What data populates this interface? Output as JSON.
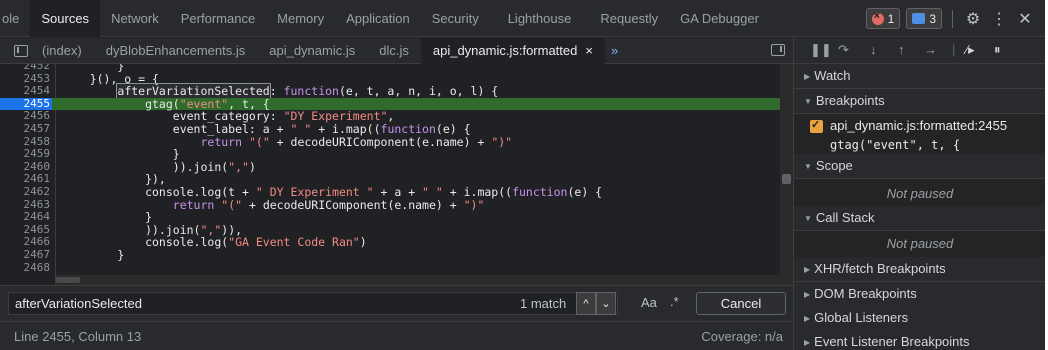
{
  "top_tabs": [
    "ole",
    "Sources",
    "Network",
    "Performance",
    "Memory",
    "Application",
    "Security",
    "Lighthouse",
    "Requestly",
    "GA Debugger"
  ],
  "top_tabs_active": "Sources",
  "errors_count": "1",
  "messages_count": "3",
  "icons": {
    "settings": "gear-icon",
    "more": "kebab-icon",
    "close": "close-icon"
  },
  "file_tabs": [
    "(index)",
    "dyBlobEnhancements.js",
    "api_dynamic.js",
    "dlc.js",
    "api_dynamic.js:formatted"
  ],
  "file_tabs_active": "api_dynamic.js:formatted",
  "file_tab_close": "×",
  "file_tabs_more": "»",
  "code_lines": [
    {
      "n": "2452",
      "t": "        }"
    },
    {
      "n": "2453",
      "t": "    }(), o = {"
    },
    {
      "n": "2454",
      "t": "        afterVariationSelected: function(e, t, a, n, i, o, l) {"
    },
    {
      "n": "2455",
      "t": "            gtag(\"event\", t, {"
    },
    {
      "n": "2456",
      "t": "                event_category: \"DY Experiment\","
    },
    {
      "n": "2457",
      "t": "                event_label: a + \" \" + i.map((function(e) {"
    },
    {
      "n": "2458",
      "t": "                    return \"(\" + decodeURIComponent(e.name) + \")\""
    },
    {
      "n": "2459",
      "t": "                }"
    },
    {
      "n": "2460",
      "t": "                )).join(\",\")"
    },
    {
      "n": "2461",
      "t": "            }),"
    },
    {
      "n": "2462",
      "t": "            console.log(t + \" DY Experiment \" + a + \" \" + i.map((function(e) {"
    },
    {
      "n": "2463",
      "t": "                return \"(\" + decodeURIComponent(e.name) + \")\""
    },
    {
      "n": "2464",
      "t": "            }"
    },
    {
      "n": "2465",
      "t": "            )).join(\",\")),"
    },
    {
      "n": "2466",
      "t": "            console.log(\"GA Event Code Ran\")"
    },
    {
      "n": "2467",
      "t": "        }"
    },
    {
      "n": "2468",
      "t": ""
    }
  ],
  "highlighted_line": "2455",
  "search": {
    "value": "afterVariationSelected",
    "match_text": "1 match",
    "up": "^",
    "down": "⌄",
    "case_label": "Aa",
    "regex_label": ".*",
    "cancel_label": "Cancel"
  },
  "status": {
    "position": "Line 2455, Column 13",
    "coverage": "Coverage: n/a"
  },
  "debugger": {
    "sections": [
      "Watch",
      "Breakpoints",
      "Scope",
      "Call Stack",
      "XHR/fetch Breakpoints",
      "DOM Breakpoints",
      "Global Listeners",
      "Event Listener Breakpoints"
    ],
    "breakpoint_label": "api_dynamic.js:formatted:2455",
    "breakpoint_code": "gtag(\"event\", t, {",
    "scope_status": "Not paused",
    "callstack_status": "Not paused"
  },
  "colors": {
    "background": "#202124",
    "highlight": "#2f6b2a",
    "active_line": "#1a73e8",
    "checkbox": "#e8a33d"
  }
}
